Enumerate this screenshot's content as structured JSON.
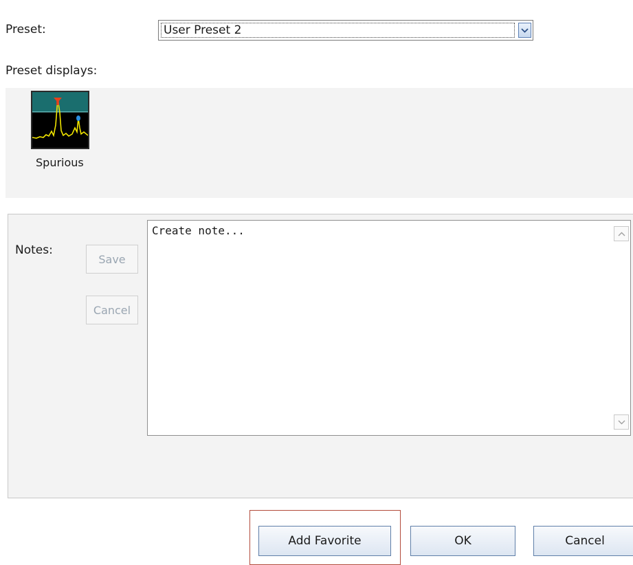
{
  "preset": {
    "label": "Preset:",
    "selected_value": "User Preset 2"
  },
  "preset_displays": {
    "label": "Preset displays:",
    "items": [
      {
        "caption": "Spurious",
        "icon": "spurious-spectrum-icon"
      }
    ]
  },
  "notes": {
    "label": "Notes:",
    "save_label": "Save",
    "cancel_label": "Cancel",
    "text": "Create note..."
  },
  "footer": {
    "add_favorite_label": "Add Favorite",
    "ok_label": "OK",
    "cancel_label": "Cancel"
  },
  "colors": {
    "highlight_border": "#b24a3a",
    "button_border": "#5e7ea8",
    "panel_background": "#f3f3f3",
    "disabled_text": "#9aa6b2",
    "trace_yellow": "#f2e600",
    "marker_red": "#e8401c",
    "marker_blue": "#2a8fe0",
    "thumbnail_top": "#1a6e6e"
  }
}
